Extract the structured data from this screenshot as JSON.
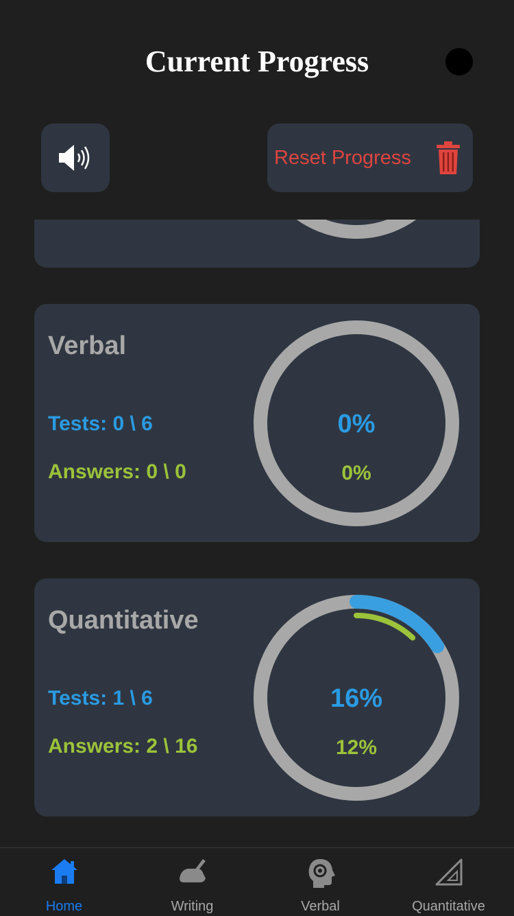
{
  "header": {
    "title": "Current Progress"
  },
  "toolbar": {
    "reset_label": "Reset Progress"
  },
  "icons": {
    "sound": "speaker-icon",
    "trash": "trash-icon"
  },
  "colors": {
    "tests": "#2a9be3",
    "answers": "#9cc33a",
    "danger": "#e0443e",
    "ring": "#a8a8a8",
    "active_tab": "#1a7cf0"
  },
  "cards": [
    {
      "title": "Verbal",
      "tests": "Tests: 0 \\ 6",
      "answers": "Answers: 0 \\ 0",
      "tests_pct": "0%",
      "answers_pct": "0%",
      "tests_fraction": 0,
      "answers_fraction": 0
    },
    {
      "title": "Quantitative",
      "tests": "Tests: 1 \\ 6",
      "answers": "Answers: 2 \\ 16",
      "tests_pct": "16%",
      "answers_pct": "12%",
      "tests_fraction": 0.16,
      "answers_fraction": 0.12
    }
  ],
  "tabs": [
    {
      "label": "Home",
      "icon": "home-icon",
      "active": true
    },
    {
      "label": "Writing",
      "icon": "writing-hand-icon",
      "active": false
    },
    {
      "label": "Verbal",
      "icon": "head-gear-icon",
      "active": false
    },
    {
      "label": "Quantitative",
      "icon": "triangle-ruler-icon",
      "active": false
    }
  ]
}
